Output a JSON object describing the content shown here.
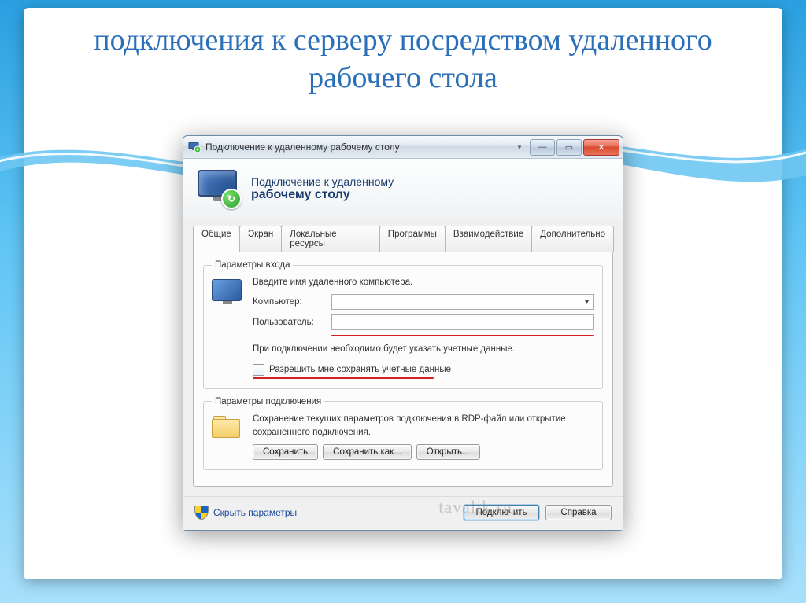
{
  "slide": {
    "title": "подключения к серверу посредством удаленного рабочего стола"
  },
  "window": {
    "title": "Подключение к удаленному рабочему столу",
    "header_line1": "Подключение к удаленному",
    "header_line2": "рабочему столу"
  },
  "tabs": [
    {
      "label": "Общие",
      "active": true
    },
    {
      "label": "Экран",
      "active": false
    },
    {
      "label": "Локальные ресурсы",
      "active": false
    },
    {
      "label": "Программы",
      "active": false
    },
    {
      "label": "Взаимодействие",
      "active": false
    },
    {
      "label": "Дополнительно",
      "active": false
    }
  ],
  "login_group": {
    "legend": "Параметры входа",
    "instruction": "Введите имя удаленного компьютера.",
    "computer_label": "Компьютер:",
    "computer_value": "",
    "user_label": "Пользователь:",
    "user_value": "",
    "hint": "При подключении необходимо будет указать учетные данные.",
    "checkbox_label": "Разрешить мне сохранять учетные данные"
  },
  "connection_group": {
    "legend": "Параметры подключения",
    "description": "Сохранение текущих параметров подключения в RDP-файл или открытие сохраненного подключения.",
    "buttons": {
      "save": "Сохранить",
      "save_as": "Сохранить как...",
      "open": "Открыть..."
    }
  },
  "footer": {
    "hide_params": "Скрыть параметры",
    "connect": "Подключить",
    "help": "Справка"
  },
  "watermark": "tavalik.ru"
}
